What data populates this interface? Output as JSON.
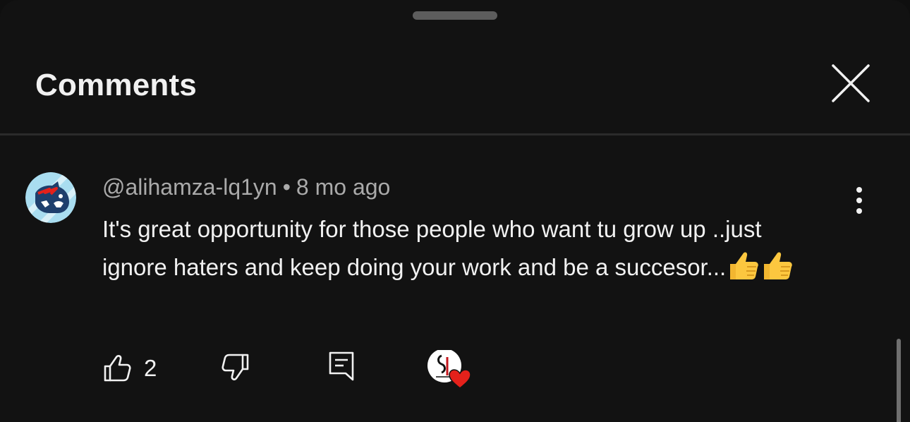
{
  "header": {
    "title": "Comments"
  },
  "comment": {
    "author": "@alihamza-lq1yn",
    "separator": "•",
    "age": "8 mo ago",
    "text": "It's great opportunity for those people who want tu grow up ..just ignore haters and keep doing your work and be a succesor...",
    "emoji": [
      "thumbs-up",
      "thumbs-up"
    ],
    "like_count": "2",
    "creator_hearted": true
  },
  "colors": {
    "background": "#121212",
    "text_primary": "#f1f1f1",
    "text_secondary": "#aaaaaa",
    "heart": "#e5211b",
    "avatar_bg": "#a9ddf0"
  },
  "icons": {
    "close": "close-icon",
    "more": "more-vertical-icon",
    "like": "thumbs-up-outline-icon",
    "dislike": "thumbs-down-outline-icon",
    "reply": "reply-comment-icon",
    "heart": "creator-heart-icon"
  }
}
